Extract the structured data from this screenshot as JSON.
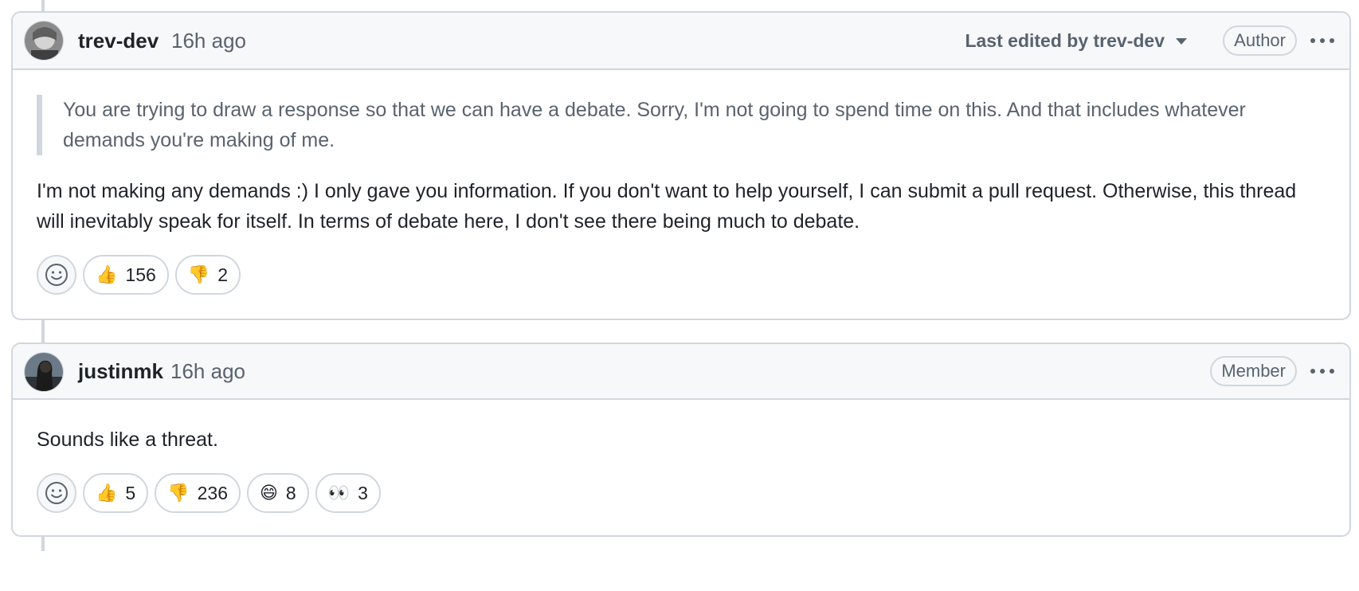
{
  "comments": [
    {
      "author": "trev-dev",
      "timestamp": "16h ago",
      "edited_prefix": "Last edited by",
      "edited_by": "trev-dev",
      "role": "Author",
      "quote": "You are trying to draw a response so that we can have a debate. Sorry, I'm not going to spend time on this. And that includes whatever demands you're making of me.",
      "body": "I'm not making any demands :) I only gave you information. If you don't want to help yourself, I can submit a pull request. Otherwise, this thread will inevitably speak for itself. In terms of debate here, I don't see there being much to debate.",
      "reactions": [
        {
          "emoji": "👍",
          "icon": "thumbs-up-icon",
          "count": "156"
        },
        {
          "emoji": "👎",
          "icon": "thumbs-down-icon",
          "count": "2"
        }
      ]
    },
    {
      "author": "justinmk",
      "timestamp": "16h ago",
      "role": "Member",
      "body": "Sounds like a threat.",
      "reactions": [
        {
          "emoji": "👍",
          "icon": "thumbs-up-icon",
          "count": "5"
        },
        {
          "emoji": "👎",
          "icon": "thumbs-down-icon",
          "count": "236"
        },
        {
          "emoji": "😄",
          "icon": "laugh-icon",
          "count": "8"
        },
        {
          "emoji": "👀",
          "icon": "eyes-icon",
          "count": "3"
        }
      ]
    }
  ],
  "colors": {
    "border": "#d0d7de",
    "header_bg": "#f6f8fa",
    "muted_text": "#59636e",
    "text": "#1f2328"
  }
}
